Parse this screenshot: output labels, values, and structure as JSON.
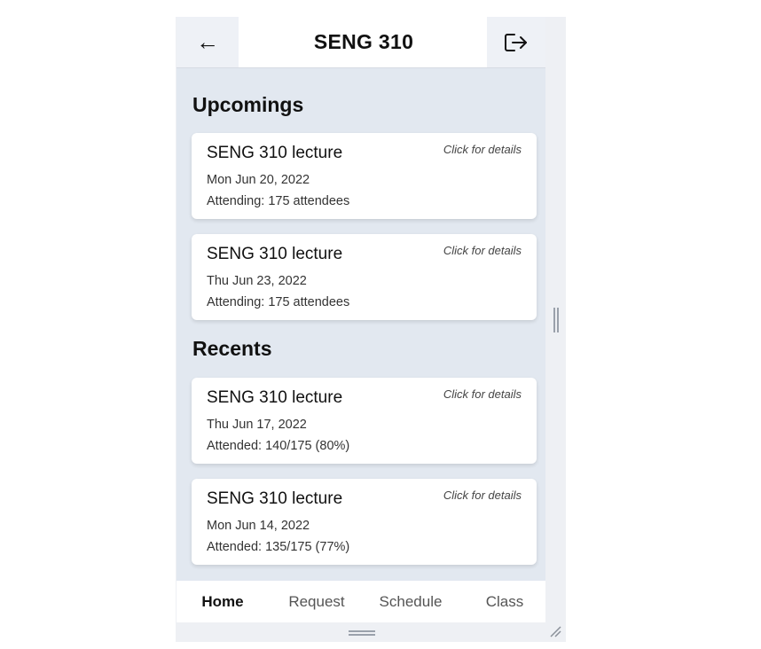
{
  "header": {
    "back_icon": "←",
    "title": "SENG 310",
    "logout_icon": "logout-icon"
  },
  "upcomings": {
    "title": "Upcomings",
    "items": [
      {
        "title": "SENG 310 lecture",
        "hint": "Click for details",
        "date": "Mon Jun 20, 2022",
        "stat": "Attending: 175 attendees"
      },
      {
        "title": "SENG 310 lecture",
        "hint": "Click for details",
        "date": "Thu Jun 23, 2022",
        "stat": "Attending: 175 attendees"
      }
    ]
  },
  "recents": {
    "title": "Recents",
    "items": [
      {
        "title": "SENG 310 lecture",
        "hint": "Click for details",
        "date": "Thu Jun 17, 2022",
        "stat": "Attended: 140/175 (80%)"
      },
      {
        "title": "SENG 310 lecture",
        "hint": "Click for details",
        "date": "Mon Jun 14, 2022",
        "stat": "Attended: 135/175 (77%)"
      }
    ]
  },
  "nav": {
    "items": [
      {
        "label": "Home",
        "active": true
      },
      {
        "label": "Request",
        "active": false
      },
      {
        "label": "Schedule",
        "active": false
      },
      {
        "label": "Class",
        "active": false
      }
    ]
  },
  "colors": {
    "content_bg": "#e2e8f0",
    "card_bg": "#ffffff",
    "header_button_bg": "#eef1f6"
  }
}
